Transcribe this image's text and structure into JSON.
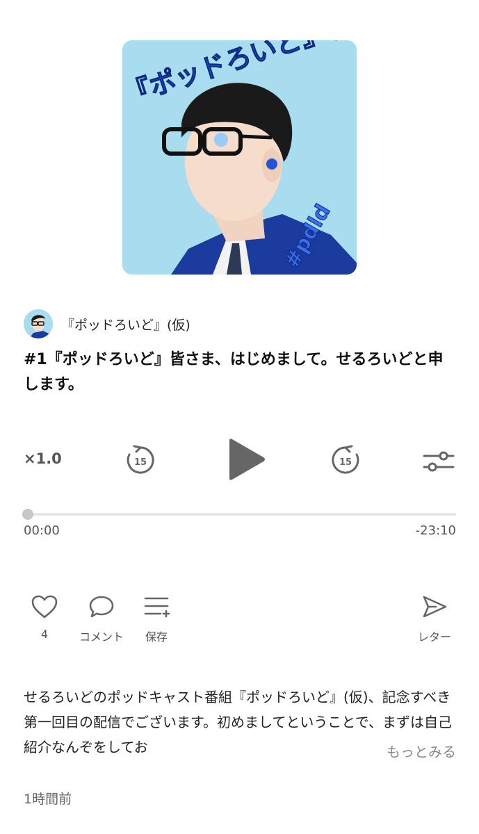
{
  "cover": {
    "title_art": "『ポッドろいど』(仮)",
    "hashtag_art": "#pdld"
  },
  "channel": {
    "name": "『ポッドろいど』(仮)"
  },
  "episode": {
    "title": "#1『ポッドろいど』皆さま、はじめまして。せるろいどと申します。"
  },
  "player": {
    "speed": "×1.0",
    "skip_back_seconds": "15",
    "skip_forward_seconds": "15",
    "elapsed": "00:00",
    "remaining": "-23:10",
    "progress_fraction": 0.0
  },
  "actions": {
    "like_count": "4",
    "comment_label": "コメント",
    "save_label": "保存",
    "letter_label": "レター"
  },
  "description": {
    "text": "せるろいどのポッドキャスト番組『ポッドろいど』(仮)、記念すべき第一回目の配信でございます。初めましてということで、まずは自己紹介なんぞをしてお",
    "more_label": "もっとみる"
  },
  "posted": "1時間前",
  "colors": {
    "cover_bg": "#a8dcef",
    "accent_blue": "#1f55d6",
    "icon_gray": "#666666",
    "play_gray": "#666666"
  }
}
